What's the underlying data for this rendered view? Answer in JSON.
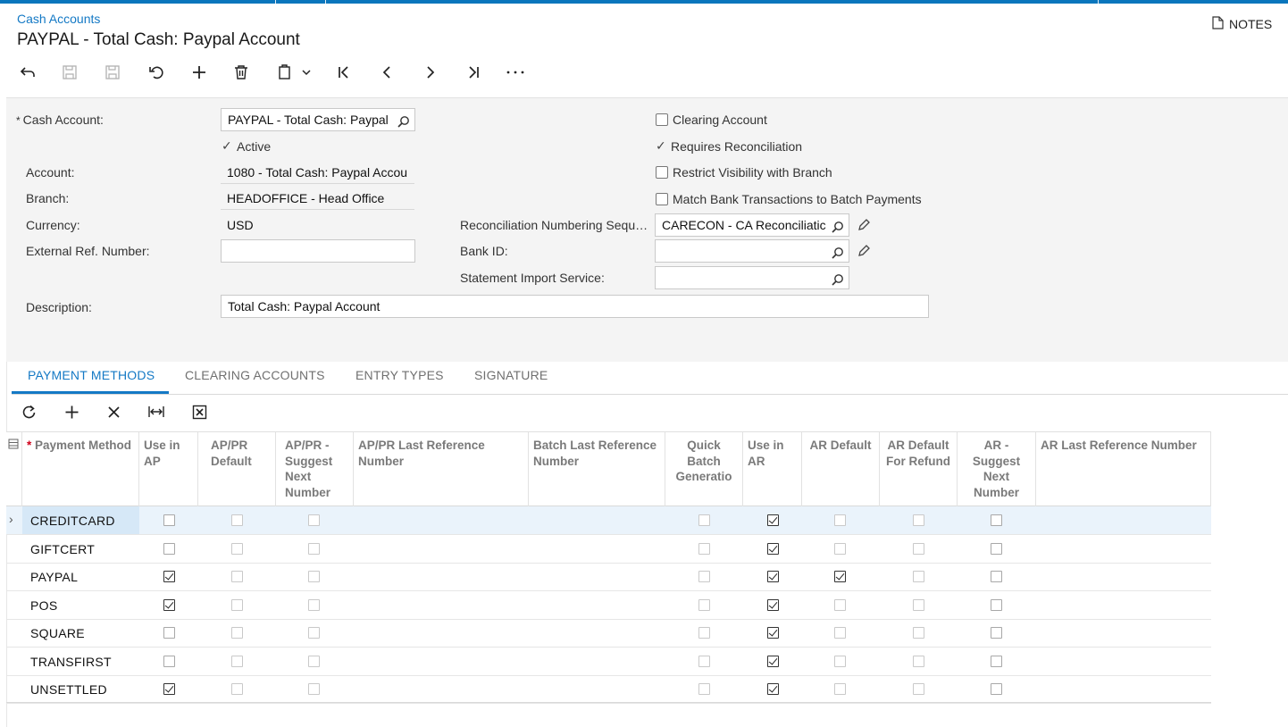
{
  "breadcrumb": "Cash Accounts",
  "title": "PAYPAL - Total Cash: Paypal Account",
  "notes_label": "NOTES",
  "toolbar": {
    "icons": [
      "back-icon",
      "cancel-icon",
      "save-icon",
      "undo-icon",
      "add-icon",
      "delete-icon",
      "copy-paste-icon",
      "first-record-icon",
      "previous-record-icon",
      "next-record-icon",
      "last-record-icon",
      "more-icon"
    ]
  },
  "form": {
    "cash_account": {
      "label": "Cash Account:",
      "required_mark": "*",
      "value": "PAYPAL - Total Cash: Paypal"
    },
    "active": {
      "label": "Active",
      "checked": true
    },
    "account": {
      "label": "Account:",
      "value": "1080 - Total Cash: Paypal Accou"
    },
    "branch": {
      "label": "Branch:",
      "value": "HEADOFFICE - Head Office"
    },
    "currency": {
      "label": "Currency:",
      "value": "USD"
    },
    "external_ref": {
      "label": "External Ref. Number:",
      "value": ""
    },
    "description": {
      "label": "Description:",
      "value": "Total Cash: Paypal Account"
    },
    "clearing_account": {
      "label": "Clearing Account",
      "checked": false
    },
    "requires_reconciliation": {
      "label": "Requires Reconciliation",
      "checked": true
    },
    "restrict_visibility": {
      "label": "Restrict Visibility with Branch",
      "checked": false
    },
    "match_bank": {
      "label": "Match Bank Transactions to Batch Payments",
      "checked": false
    },
    "reconciliation_seq": {
      "label": "Reconciliation Numbering Sequ…",
      "value": "CARECON - CA Reconciliatic"
    },
    "bank_id": {
      "label": "Bank ID:",
      "value": ""
    },
    "statement_import": {
      "label": "Statement Import Service:",
      "value": ""
    }
  },
  "tabs": [
    {
      "label": "PAYMENT METHODS",
      "active": true
    },
    {
      "label": "CLEARING ACCOUNTS",
      "active": false
    },
    {
      "label": "ENTRY TYPES",
      "active": false
    },
    {
      "label": "SIGNATURE",
      "active": false
    }
  ],
  "grid_toolbar": {
    "icons": [
      "refresh-icon",
      "add-row-icon",
      "delete-row-icon",
      "fit-columns-icon",
      "export-excel-icon"
    ]
  },
  "grid": {
    "columns": [
      {
        "key": "payment_method",
        "label": "Payment Method",
        "required": true
      },
      {
        "key": "use_in_ap",
        "label": "Use in AP"
      },
      {
        "key": "appr_default",
        "label": "AP/PR Default"
      },
      {
        "key": "appr_suggest",
        "label": "AP/PR - Suggest Next Number"
      },
      {
        "key": "appr_last_ref",
        "label": "AP/PR Last Reference Number"
      },
      {
        "key": "batch_last_ref",
        "label": "Batch Last Reference Number"
      },
      {
        "key": "quick_batch",
        "label": "Quick Batch Generatio"
      },
      {
        "key": "use_in_ar",
        "label": "Use in AR"
      },
      {
        "key": "ar_default",
        "label": "AR Default"
      },
      {
        "key": "ar_default_refund",
        "label": "AR Default For Refund"
      },
      {
        "key": "ar_suggest",
        "label": "AR - Suggest Next Number"
      },
      {
        "key": "ar_last_ref",
        "label": "AR Last Reference Number"
      }
    ],
    "rows": [
      {
        "method": "CREDITCARD",
        "use_in_ap": false,
        "appr_default": false,
        "appr_suggest": false,
        "quick_batch": false,
        "use_in_ar": true,
        "ar_default": false,
        "ar_default_refund": false,
        "ar_suggest": false,
        "selected": true
      },
      {
        "method": "GIFTCERT",
        "use_in_ap": false,
        "appr_default": false,
        "appr_suggest": false,
        "quick_batch": false,
        "use_in_ar": true,
        "ar_default": false,
        "ar_default_refund": false,
        "ar_suggest": false,
        "selected": false
      },
      {
        "method": "PAYPAL",
        "use_in_ap": true,
        "appr_default": false,
        "appr_suggest": false,
        "quick_batch": false,
        "use_in_ar": true,
        "ar_default": true,
        "ar_default_refund": false,
        "ar_suggest": false,
        "selected": false
      },
      {
        "method": "POS",
        "use_in_ap": true,
        "appr_default": false,
        "appr_suggest": false,
        "quick_batch": false,
        "use_in_ar": true,
        "ar_default": false,
        "ar_default_refund": false,
        "ar_suggest": false,
        "selected": false
      },
      {
        "method": "SQUARE",
        "use_in_ap": false,
        "appr_default": false,
        "appr_suggest": false,
        "quick_batch": false,
        "use_in_ar": true,
        "ar_default": false,
        "ar_default_refund": false,
        "ar_suggest": false,
        "selected": false
      },
      {
        "method": "TRANSFIRST",
        "use_in_ap": false,
        "appr_default": false,
        "appr_suggest": false,
        "quick_batch": false,
        "use_in_ar": true,
        "ar_default": false,
        "ar_default_refund": false,
        "ar_suggest": false,
        "selected": false
      },
      {
        "method": "UNSETTLED",
        "use_in_ap": true,
        "appr_default": false,
        "appr_suggest": false,
        "quick_batch": false,
        "use_in_ar": true,
        "ar_default": false,
        "ar_default_refund": false,
        "ar_suggest": false,
        "selected": false
      }
    ]
  }
}
